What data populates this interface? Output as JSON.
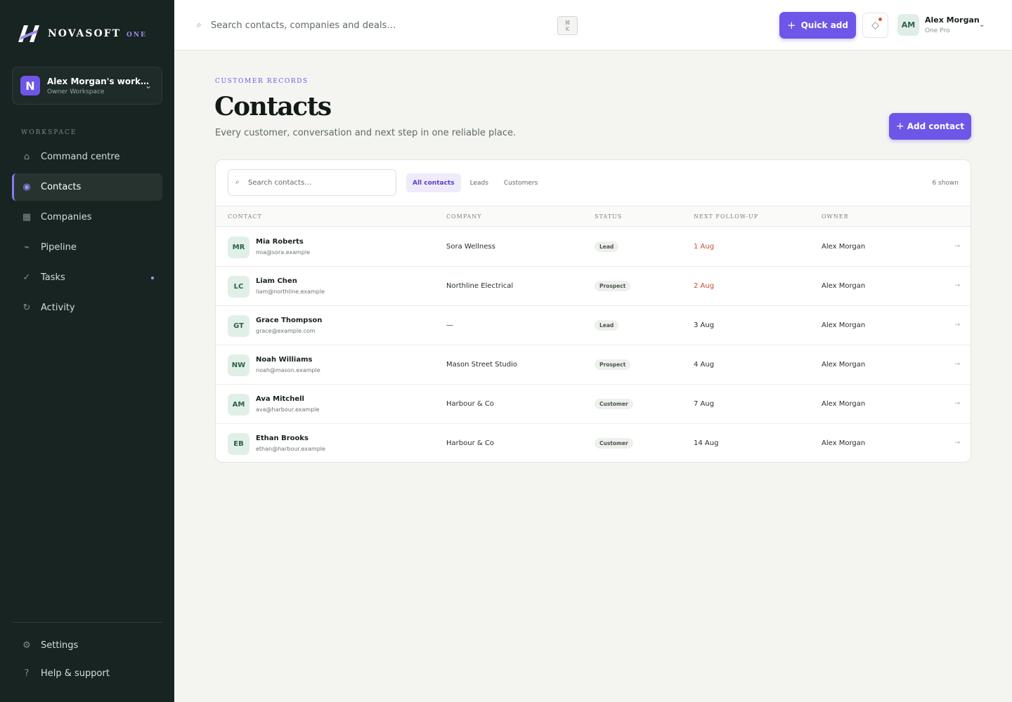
{
  "brand": {
    "name": "NOVASOFT",
    "sub": "ONE"
  },
  "workspace": {
    "avatar": "N",
    "name": "Alex Morgan's work…",
    "role": "Owner Workspace"
  },
  "nav": {
    "section_label": "WORKSPACE",
    "items": [
      {
        "label": "Command centre",
        "icon": "home-icon",
        "glyph": "⌂"
      },
      {
        "label": "Contacts",
        "icon": "contacts-icon",
        "glyph": "◉"
      },
      {
        "label": "Companies",
        "icon": "companies-icon",
        "glyph": "▦"
      },
      {
        "label": "Pipeline",
        "icon": "pipeline-icon",
        "glyph": "⌁"
      },
      {
        "label": "Tasks",
        "icon": "check-icon",
        "glyph": "✓"
      },
      {
        "label": "Activity",
        "icon": "activity-icon",
        "glyph": "↻"
      }
    ],
    "bottom": [
      {
        "label": "Settings",
        "icon": "gear-icon",
        "glyph": "⚙"
      },
      {
        "label": "Help & support",
        "icon": "help-icon",
        "glyph": "?"
      }
    ]
  },
  "topbar": {
    "search_placeholder": "Search contacts, companies and deals…",
    "shortcut": "⌘\nK",
    "quick_add_label": "Quick add",
    "user": {
      "initials": "AM",
      "name": "Alex Morgan",
      "plan": "One Pro"
    }
  },
  "page": {
    "eyebrow": "CUSTOMER RECORDS",
    "title": "Contacts",
    "subtitle": "Every customer, conversation and next step in one reliable place.",
    "add_label": "Add contact"
  },
  "table": {
    "search_placeholder": "Search contacts…",
    "tabs": [
      "All contacts",
      "Leads",
      "Customers"
    ],
    "count_label": "6 shown",
    "columns": [
      "CONTACT",
      "COMPANY",
      "STATUS",
      "NEXT FOLLOW-UP",
      "OWNER"
    ],
    "rows": [
      {
        "initials": "MR",
        "name": "Mia Roberts",
        "email": "mia@sora.example",
        "company": "Sora Wellness",
        "status": "Lead",
        "followup": "1 Aug",
        "overdue": true,
        "owner": "Alex Morgan"
      },
      {
        "initials": "LC",
        "name": "Liam Chen",
        "email": "liam@northline.example",
        "company": "Northline Electrical",
        "status": "Prospect",
        "followup": "2 Aug",
        "overdue": true,
        "owner": "Alex Morgan"
      },
      {
        "initials": "GT",
        "name": "Grace Thompson",
        "email": "grace@example.com",
        "company": "—",
        "status": "Lead",
        "followup": "3 Aug",
        "overdue": false,
        "owner": "Alex Morgan"
      },
      {
        "initials": "NW",
        "name": "Noah Williams",
        "email": "noah@mason.example",
        "company": "Mason Street Studio",
        "status": "Prospect",
        "followup": "4 Aug",
        "overdue": false,
        "owner": "Alex Morgan"
      },
      {
        "initials": "AM",
        "name": "Ava Mitchell",
        "email": "ava@harbour.example",
        "company": "Harbour & Co",
        "status": "Customer",
        "followup": "7 Aug",
        "overdue": false,
        "owner": "Alex Morgan"
      },
      {
        "initials": "EB",
        "name": "Ethan Brooks",
        "email": "ethan@harbour.example",
        "company": "Harbour & Co",
        "status": "Customer",
        "followup": "14 Aug",
        "overdue": false,
        "owner": "Alex Morgan"
      }
    ]
  },
  "colors": {
    "accent": "#6e56e8",
    "sidebar": "#182421",
    "overdue": "#cc4a33"
  }
}
